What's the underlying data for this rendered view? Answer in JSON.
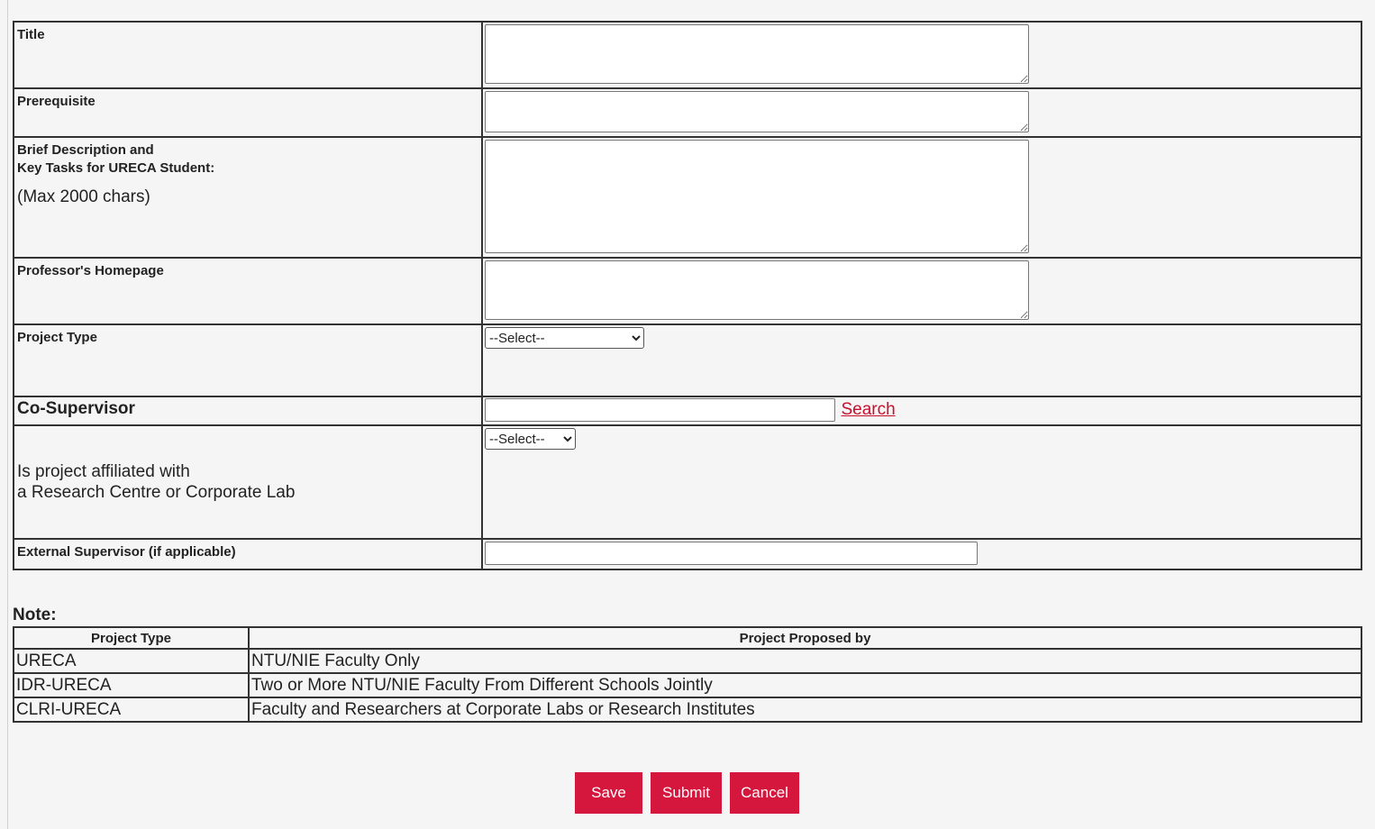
{
  "form": {
    "title_label": "Title",
    "prerequisite_label": "Prerequisite",
    "description_label_line1": "Brief Description and",
    "description_label_line2": "Key Tasks for URECA Student:",
    "description_hint": "(Max 2000 chars)",
    "homepage_label": "Professor's Homepage",
    "project_type_label": "Project Type",
    "project_type_selected": "--Select--",
    "co_supervisor_label": "Co-Supervisor",
    "search_link": "Search",
    "affiliated_label_line1": "Is project affiliated with",
    "affiliated_label_line2": "a Research Centre or Corporate Lab",
    "affiliated_selected": "--Select--",
    "external_supervisor_label": "External Supervisor (if applicable)"
  },
  "note": {
    "title": "Note:",
    "headers": [
      "Project Type",
      "Project Proposed by"
    ],
    "rows": [
      [
        "URECA",
        "NTU/NIE Faculty Only"
      ],
      [
        "IDR-URECA",
        "Two or More NTU/NIE Faculty From Different Schools Jointly"
      ],
      [
        "CLRI-URECA",
        "Faculty and Researchers at Corporate Labs or Research Institutes"
      ]
    ]
  },
  "buttons": {
    "save": "Save",
    "submit": "Submit",
    "cancel": "Cancel"
  },
  "colors": {
    "accent": "#d6173d",
    "link": "#c8102e"
  }
}
